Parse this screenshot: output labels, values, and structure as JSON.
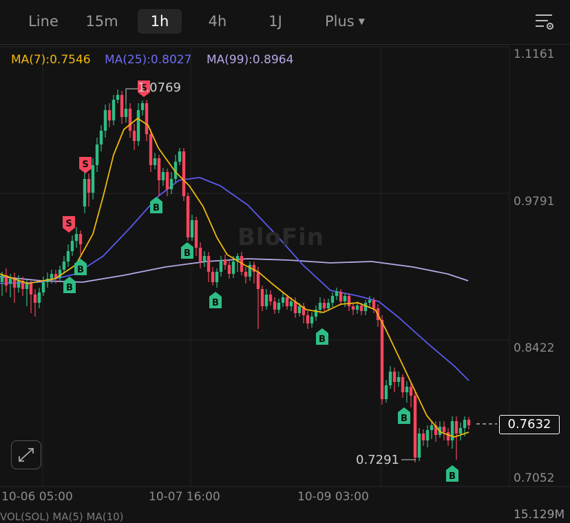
{
  "toolbar": {
    "timeframes": [
      "Line",
      "15m",
      "1h",
      "4h",
      "1J"
    ],
    "active": "1h",
    "plus_label": "Plus"
  },
  "indicators": {
    "ma7": "MA(7):0.7546",
    "ma25": "MA(25):0.8027",
    "ma99": "MA(99):0.8964"
  },
  "price_axis": [
    "1.1161",
    "0.9791",
    "0.8422",
    "0.7052"
  ],
  "time_axis": [
    "10-06 05:00",
    "10-07 16:00",
    "10-09 03:00"
  ],
  "last_price": "0.7632",
  "annotations": {
    "high": "1.0769",
    "low": "0.7291"
  },
  "watermark": "BloFin",
  "volume": {
    "max_label": "15.129M",
    "legend": "VOL(SOL) MA(5)  MA(10)"
  },
  "markers": {
    "buy": "B",
    "sell": "S"
  },
  "colors": {
    "up": "#2ebd85",
    "down": "#f6465d",
    "ma7": "#f0b90b",
    "ma25": "#5b5bf0",
    "ma99": "#b9a9e8",
    "background": "#131313"
  }
}
